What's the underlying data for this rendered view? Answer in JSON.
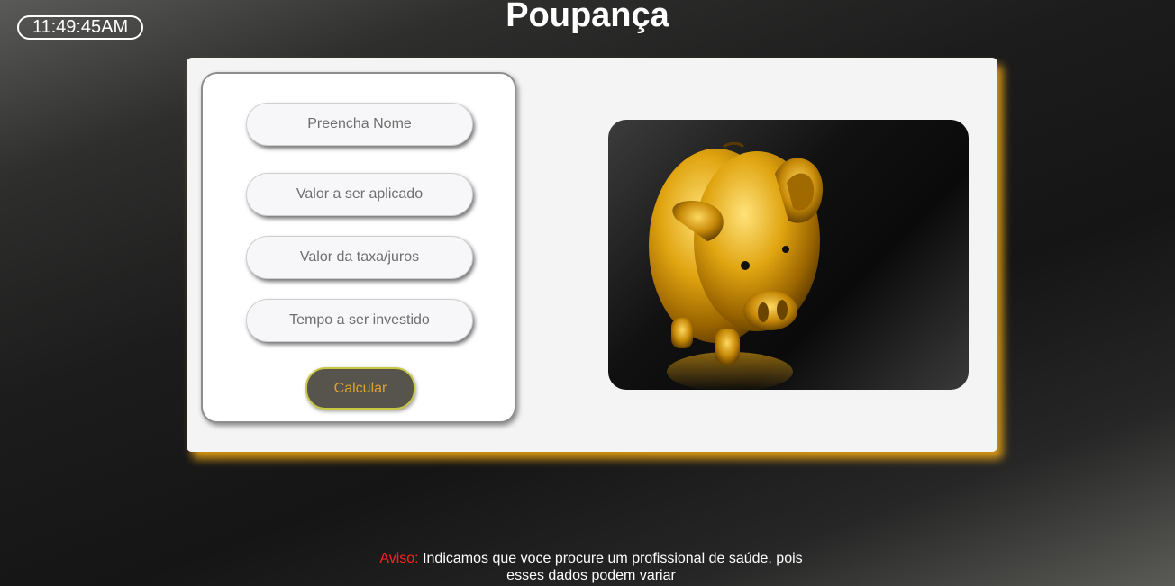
{
  "clock": {
    "time": "11:49:45AM"
  },
  "header": {
    "title": "Poupança"
  },
  "form": {
    "name_placeholder": "Preencha Nome",
    "amount_placeholder": "Valor a ser aplicado",
    "rate_placeholder": "Valor da taxa/juros",
    "time_placeholder": "Tempo a ser investido",
    "submit_label": "Calcular"
  },
  "image": {
    "subject": "golden piggy bank",
    "icon": "piggy-bank-image"
  },
  "notice": {
    "label": "Aviso:",
    "text": "Indicamos que voce procure um profissional de saúde, pois esses dados podem variar"
  },
  "colors": {
    "card_glow": "#f5aa14",
    "button_bg": "#56544d",
    "button_text": "#e0a030",
    "notice_label": "#ff2020"
  }
}
